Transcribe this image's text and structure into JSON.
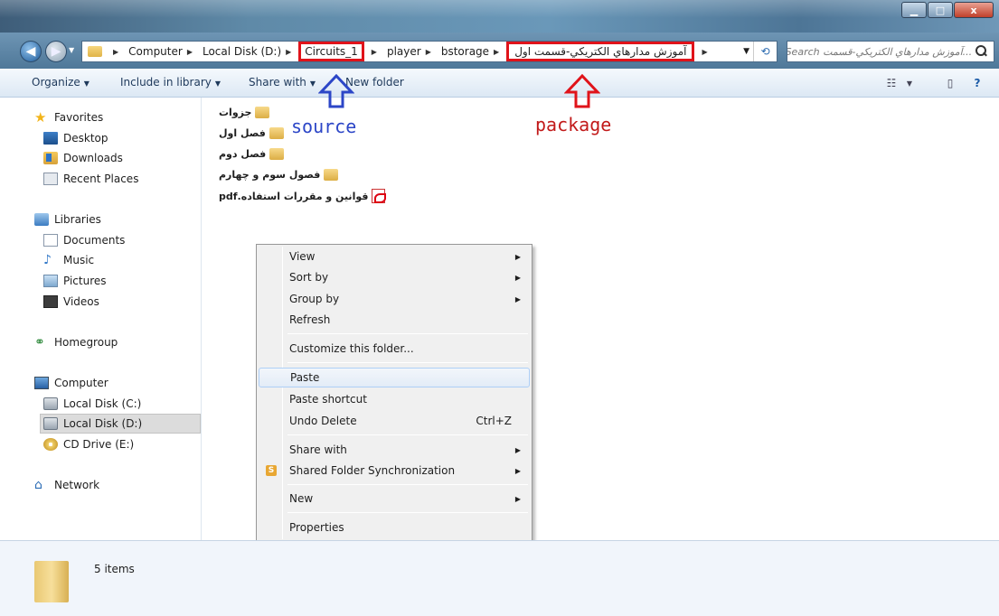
{
  "window": {
    "controls": {
      "minimize": "▁",
      "maximize": "□",
      "close": "x"
    }
  },
  "nav": {
    "back_icon": "arrow-left-icon",
    "forward_icon": "arrow-right-icon"
  },
  "breadcrumbs": [
    "Computer",
    "Local Disk (D:)",
    "Circuits_1",
    "player",
    "bstorage",
    "آموزش مدارهاي الكتريكي-قسمت اول"
  ],
  "search": {
    "placeholder": "...آموزش مدارهاي الكتريكي-قسمت Search"
  },
  "commandbar": {
    "organize": "Organize",
    "include": "Include in library",
    "share": "Share with",
    "new_folder": "New folder"
  },
  "sidebar": {
    "favorites": "Favorites",
    "desktop": "Desktop",
    "downloads": "Downloads",
    "recent": "Recent Places",
    "libraries": "Libraries",
    "documents": "Documents",
    "music": "Music",
    "pictures": "Pictures",
    "videos": "Videos",
    "homegroup": "Homegroup",
    "computer": "Computer",
    "disk_c": "Local Disk (C:)",
    "disk_d": "Local Disk (D:)",
    "cd": "CD Drive (E:)",
    "network": "Network"
  },
  "files": [
    {
      "name": "جزوات",
      "type": "folder"
    },
    {
      "name": "فصل اول",
      "type": "folder"
    },
    {
      "name": "فصل دوم",
      "type": "folder"
    },
    {
      "name": "فصول سوم و چهارم",
      "type": "folder"
    },
    {
      "name": "قوانين و مقررات استفاده.pdf",
      "type": "pdf"
    }
  ],
  "annotations": {
    "source": "source",
    "package": "package",
    "blue_color": "#2c46c7",
    "red_color": "#e0131a"
  },
  "context_menu": {
    "view": "View",
    "sort_by": "Sort by",
    "group_by": "Group by",
    "refresh": "Refresh",
    "customize": "Customize this folder...",
    "paste": "Paste",
    "paste_shortcut": "Paste shortcut",
    "undo_delete": "Undo Delete",
    "undo_shortcut": "Ctrl+Z",
    "share_with": "Share with",
    "shared_sync": "Shared Folder Synchronization",
    "new": "New",
    "properties": "Properties"
  },
  "details": {
    "count": "5 items"
  }
}
